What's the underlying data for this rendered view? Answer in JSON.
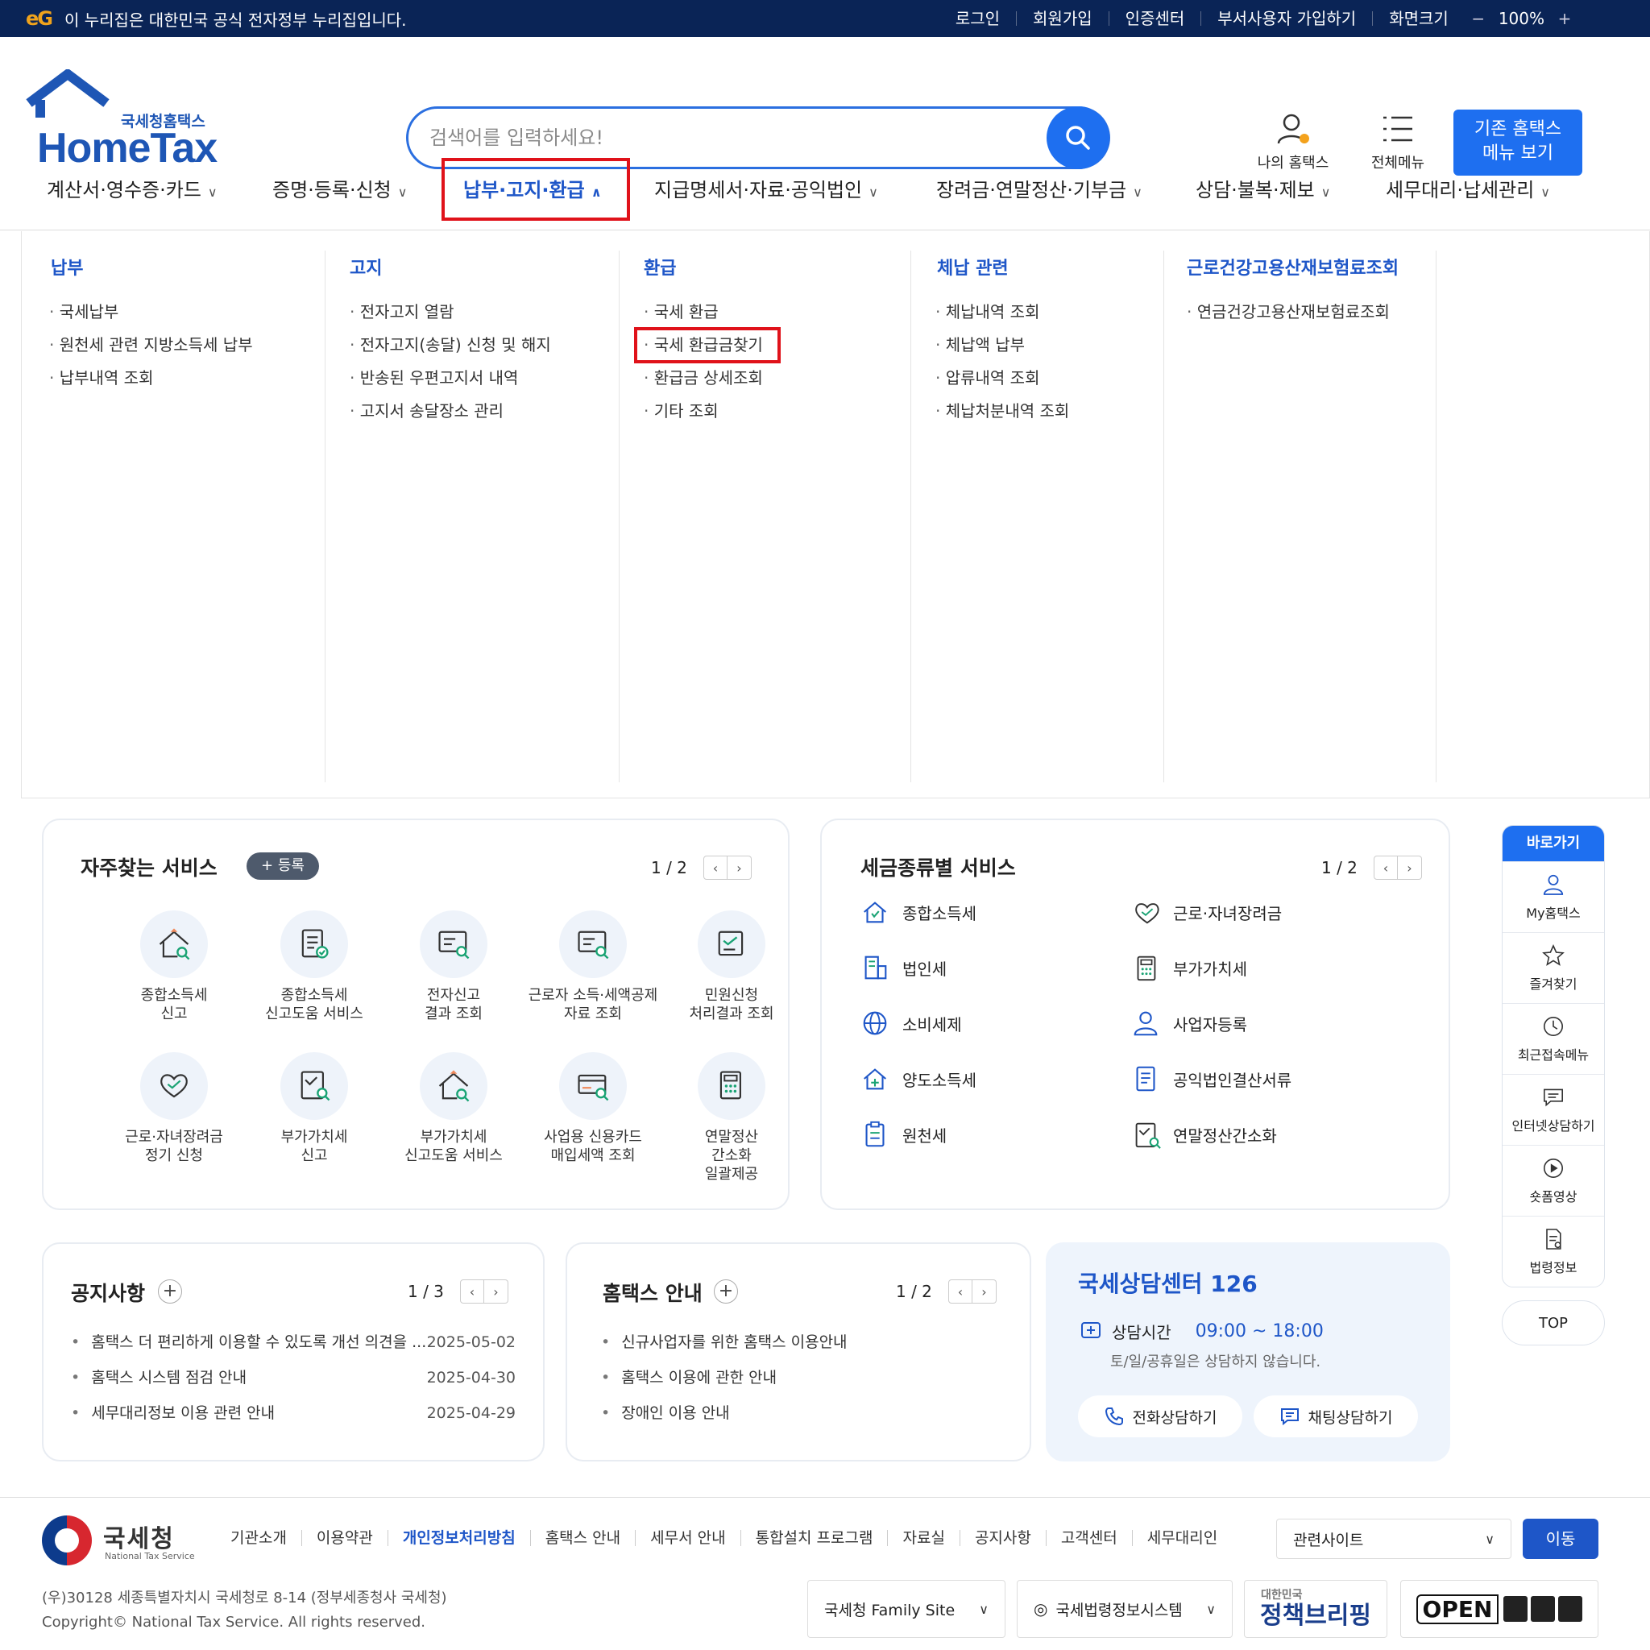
{
  "gov_bar": {
    "logo": "eG",
    "text": "이 누리집은 대한민국 공식 전자정부 누리집입니다.",
    "links": [
      "로그인",
      "회원가입",
      "인증센터",
      "부서사용자 가입하기",
      "화면크기"
    ],
    "zoom_minus": "−",
    "zoom_value": "100%",
    "zoom_plus": "+"
  },
  "header": {
    "logo_sub": "국세청홈택스",
    "logo_main": "HomeTax",
    "search_placeholder": "검색어를 입력하세요!",
    "my_hometax": "나의 홈택스",
    "all_menu": "전체메뉴",
    "legacy_btn_line1": "기존 홈택스",
    "legacy_btn_line2": "메뉴 보기"
  },
  "gnb": [
    {
      "label": "계산서·영수증·카드"
    },
    {
      "label": "증명·등록·신청"
    },
    {
      "label": "납부·고지·환급",
      "active": true
    },
    {
      "label": "지급명세서·자료·공익법인"
    },
    {
      "label": "장려금·연말정산·기부금"
    },
    {
      "label": "상담·불복·제보"
    },
    {
      "label": "세무대리·납세관리"
    }
  ],
  "mega_menu": [
    {
      "title": "납부",
      "items": [
        "국세납부",
        "원천세 관련 지방소득세 납부",
        "납부내역 조회"
      ]
    },
    {
      "title": "고지",
      "items": [
        "전자고지 열람",
        "전자고지(송달) 신청 및 해지",
        "반송된 우편고지서 내역",
        "고지서 송달장소 관리"
      ]
    },
    {
      "title": "환급",
      "items": [
        "국세 환급",
        "국세 환급금찾기",
        "환급금 상세조회",
        "기타 조회"
      ]
    },
    {
      "title": "체납 관련",
      "items": [
        "체납내역 조회",
        "체납액 납부",
        "압류내역 조회",
        "체납처분내역 조회"
      ]
    },
    {
      "title": "근로건강고용산재보험료조회",
      "items": [
        "연금건강고용산재보험료조회"
      ]
    }
  ],
  "favorites": {
    "title": "자주찾는 서비스",
    "register": "+ 등록",
    "page": "1 / 2",
    "prev": "‹",
    "next": "›",
    "items": [
      {
        "line1": "종합소득세",
        "line2": "신고",
        "line3": "",
        "icon": "house-search-icon"
      },
      {
        "line1": "종합소득세",
        "line2": "신고도움 서비스",
        "line3": "",
        "icon": "checklist-icon"
      },
      {
        "line1": "전자신고",
        "line2": "결과 조회",
        "line3": "",
        "icon": "monitor-search-icon"
      },
      {
        "line1": "근로자 소득·세액공제",
        "line2": "자료 조회",
        "line3": "",
        "icon": "monitor-search-icon"
      },
      {
        "line1": "민원신청",
        "line2": "처리결과 조회",
        "line3": "",
        "icon": "document-check-icon"
      },
      {
        "line1": "근로·자녀장려금",
        "line2": "정기 신청",
        "line3": "",
        "icon": "heart-icon"
      },
      {
        "line1": "부가가치세",
        "line2": "신고",
        "line3": "",
        "icon": "document-search-icon"
      },
      {
        "line1": "부가가치세",
        "line2": "신고도움 서비스",
        "line3": "",
        "icon": "house-search-icon"
      },
      {
        "line1": "사업용 신용카드",
        "line2": "매입세액 조회",
        "line3": "",
        "icon": "card-search-icon"
      },
      {
        "line1": "연말정산",
        "line2": "간소화",
        "line3": "일괄제공",
        "icon": "calculator-icon"
      }
    ]
  },
  "tax_services": {
    "title": "세금종류별 서비스",
    "page": "1 / 2",
    "prev": "‹",
    "next": "›",
    "items": [
      {
        "label": "종합소득세",
        "icon": "house-icon"
      },
      {
        "label": "근로·자녀장려금",
        "icon": "heart-icon"
      },
      {
        "label": "법인세",
        "icon": "building-icon"
      },
      {
        "label": "부가가치세",
        "icon": "calculator-icon"
      },
      {
        "label": "소비세제",
        "icon": "globe-icon"
      },
      {
        "label": "사업자등록",
        "icon": "person-icon"
      },
      {
        "label": "양도소득세",
        "icon": "house-plus-icon"
      },
      {
        "label": "공익법인결산서류",
        "icon": "document-icon"
      },
      {
        "label": "원천세",
        "icon": "clipboard-icon"
      },
      {
        "label": "연말정산간소화",
        "icon": "document-search-icon"
      }
    ]
  },
  "quick_bar": {
    "title": "바로가기",
    "items": [
      {
        "label": "My홈택스",
        "icon": "person-icon"
      },
      {
        "label": "즐겨찾기",
        "icon": "star-icon"
      },
      {
        "label": "최근접속메뉴",
        "icon": "clock-icon"
      },
      {
        "label": "인터넷상담하기",
        "icon": "chat-icon"
      },
      {
        "label": "숏폼영상",
        "icon": "play-icon"
      },
      {
        "label": "법령정보",
        "icon": "law-doc-icon"
      }
    ],
    "top": "TOP"
  },
  "notices": {
    "title": "공지사항",
    "page": "1 / 3",
    "prev": "‹",
    "next": "›",
    "items": [
      {
        "text": "홈택스 더 편리하게 이용할 수 있도록 개선 의견을 ...",
        "date": "2025-05-02"
      },
      {
        "text": "홈택스 시스템 점검 안내",
        "date": "2025-04-30"
      },
      {
        "text": "세무대리정보 이용 관련 안내",
        "date": "2025-04-29"
      }
    ]
  },
  "guide": {
    "title": "홈택스 안내",
    "page": "1 / 2",
    "prev": "‹",
    "next": "›",
    "items": [
      "신규사업자를 위한 홈택스 이용안내",
      "홈택스 이용에 관한 안내",
      "장애인 이용 안내"
    ]
  },
  "consult": {
    "title": "국세상담센터 126",
    "hours_label": "상담시간",
    "hours": "09:00 ~ 18:00",
    "note": "토/일/공휴일은 상담하지 않습니다.",
    "phone": "전화상담하기",
    "chat": "채팅상담하기"
  },
  "footer": {
    "org": "국세청",
    "org_en": "National Tax Service",
    "links": [
      "기관소개",
      "이용약관",
      "개인정보처리방침",
      "홈택스 안내",
      "세무서 안내",
      "통합설치 프로그램",
      "자료실",
      "공지사항",
      "고객센터",
      "세무대리인"
    ],
    "related": "관련사이트",
    "go": "이동",
    "address": "(우)30128 세종특별자치시 국세청로 8-14 (정부세종청사 국세청)",
    "copyright": "Copyright© National Tax Service. All rights reserved.",
    "family_site": "국세청 Family Site",
    "law_system": "국세법령정보시스템",
    "policy_small": "대한민국",
    "policy": "정책브리핑",
    "open": "OPEN"
  },
  "colors": {
    "primary": "#1e6ff0",
    "navy": "#0a2456",
    "highlight_red": "#e0121a",
    "link_blue": "#1e56c8"
  }
}
